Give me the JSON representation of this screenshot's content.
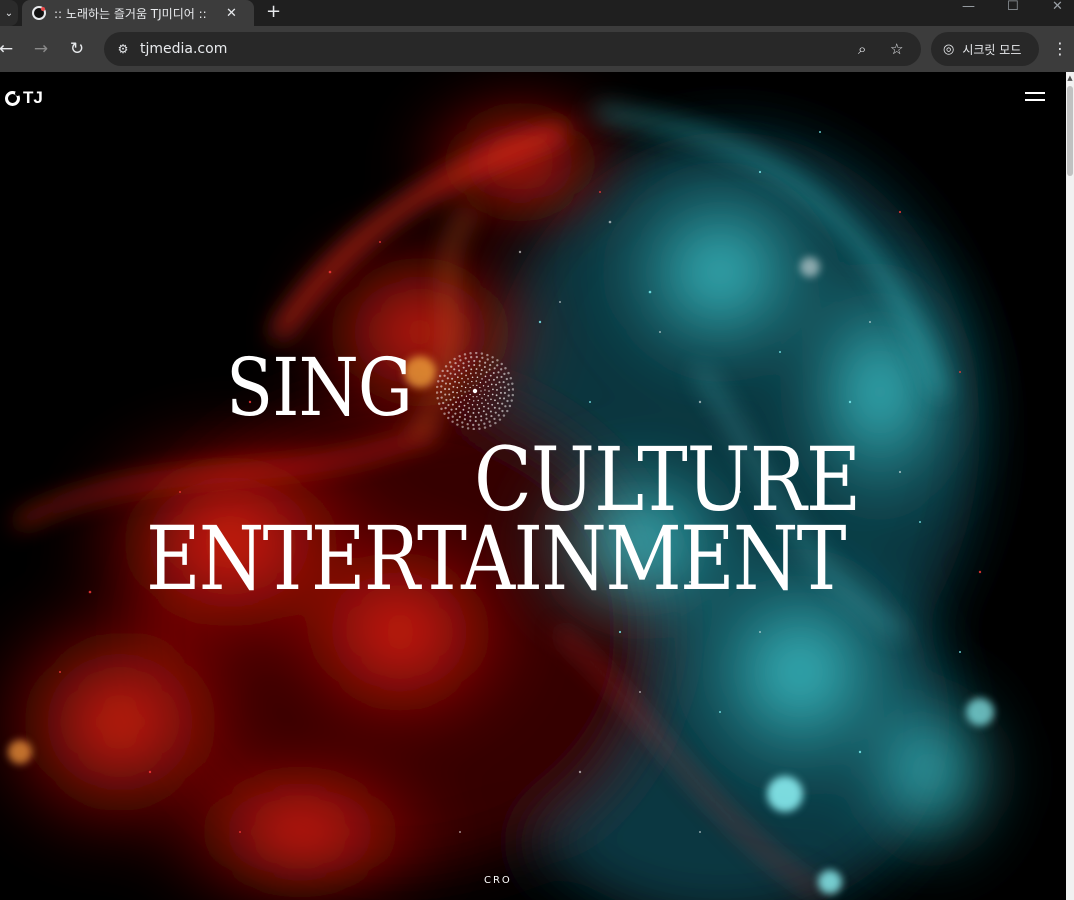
{
  "browser": {
    "tab_title": ":: 노래하는 즐거움 TJ미디어 ::",
    "url": "tjmedia.com",
    "incognito_label": "시크릿 모드",
    "icons": {
      "tab_favicon": "tj-favicon-icon",
      "tab_close": "close-icon",
      "new_tab": "plus-icon",
      "back": "back-arrow-icon",
      "forward": "forward-arrow-icon",
      "reload": "reload-icon",
      "site_info": "site-info-icon",
      "zoom": "zoom-icon",
      "bookmark": "star-icon",
      "incognito": "incognito-icon",
      "menu": "more-vertical-icon",
      "minimize": "minimize-icon",
      "maximize": "maximize-icon",
      "close_window": "close-icon"
    }
  },
  "site": {
    "logo_text": "TJ",
    "menu_icon": "hamburger-icon",
    "headline": {
      "line1": "SING",
      "line2": "CULTURE",
      "line3": "ENTERTAINMENT"
    },
    "scroll_hint": "CRO",
    "colors": {
      "background": "#000000",
      "accent_red": "#ff1a1a",
      "accent_cyan": "#3fe0e8",
      "text": "#ffffff"
    }
  }
}
